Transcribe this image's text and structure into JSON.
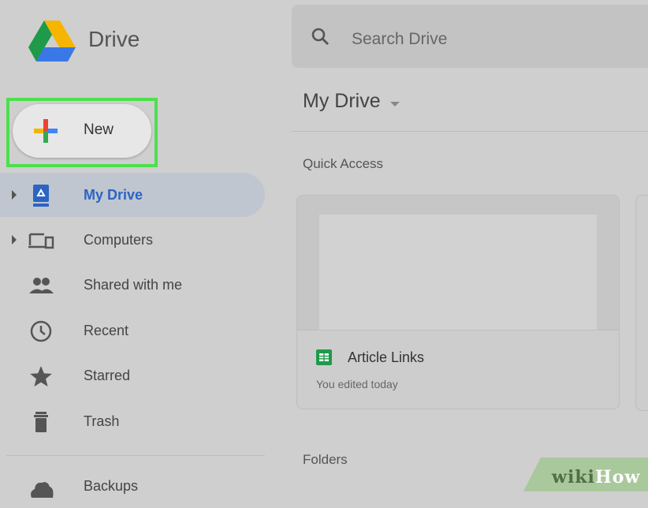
{
  "app": {
    "name": "Drive"
  },
  "sidebar": {
    "new_button": {
      "label": "New"
    },
    "items": [
      {
        "label": "My Drive",
        "icon": "my-drive-icon",
        "active": true,
        "expandable": true
      },
      {
        "label": "Computers",
        "icon": "computers-icon",
        "active": false,
        "expandable": true
      },
      {
        "label": "Shared with me",
        "icon": "shared-people-icon",
        "active": false,
        "expandable": false
      },
      {
        "label": "Recent",
        "icon": "clock-icon",
        "active": false,
        "expandable": false
      },
      {
        "label": "Starred",
        "icon": "star-icon",
        "active": false,
        "expandable": false
      },
      {
        "label": "Trash",
        "icon": "trash-icon",
        "active": false,
        "expandable": false
      },
      {
        "label": "Backups",
        "icon": "cloud-icon",
        "active": false,
        "expandable": false
      }
    ]
  },
  "search": {
    "placeholder": "Search Drive"
  },
  "main": {
    "title": "My Drive",
    "quick_access_label": "Quick Access",
    "folders_label": "Folders",
    "quick_access_files": [
      {
        "name": "Article Links",
        "subtitle": "You edited today",
        "icon": "sheets-icon"
      }
    ]
  },
  "watermark": {
    "part1": "wiki",
    "part2": "How"
  },
  "colors": {
    "highlight": "#4ce04c",
    "active_nav_text": "#2c64c4",
    "active_nav_bg": "#bfc6cf",
    "sheets_green": "#1e9a4a"
  }
}
